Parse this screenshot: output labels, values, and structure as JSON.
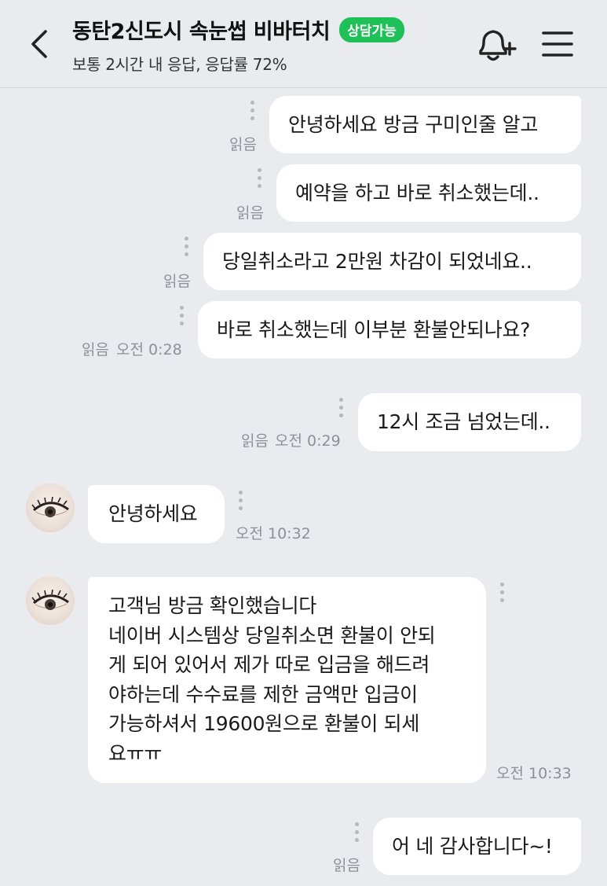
{
  "header": {
    "title": "동탄2신도시 속눈썹 비바터치",
    "badge": "상담가능",
    "subtitle": "보통 2시간 내 응답, 응답률 72%"
  },
  "messages": [
    {
      "dir": "out",
      "text": "안녕하세요 방금 구미인줄 알고",
      "read": "읽음",
      "time": ""
    },
    {
      "dir": "out",
      "text": "예약을 하고 바로 취소했는데..",
      "read": "읽음",
      "time": ""
    },
    {
      "dir": "out",
      "text": "당일취소라고 2만원 차감이 되었네요..",
      "read": "읽음",
      "time": ""
    },
    {
      "dir": "out",
      "text": "바로 취소했는데 이부분 환불안되나요?",
      "read": "읽음",
      "time": "오전 0:28"
    },
    {
      "dir": "out",
      "text": "12시 조금 넘었는데..",
      "read": "읽음",
      "time": "오전 0:29"
    },
    {
      "dir": "in",
      "text": "안녕하세요",
      "time": "오전 10:32"
    },
    {
      "dir": "in",
      "text": "고객님 방금 확인했습니다\n네이버 시스템상 당일취소면 환불이 안되\n게 되어 있어서 제가 따로 입금을 해드려\n야하는데 수수료를 제한 금액만 입금이\n가능하셔서 19600원으로 환불이 되세\n요ㅠㅠ",
      "time": "오전 10:33"
    },
    {
      "dir": "out",
      "text": "어 네 감사합니다~!",
      "read": "읽음",
      "time": ""
    }
  ],
  "colors": {
    "background": "#e9ebef",
    "bubble": "#ffffff",
    "badge": "#1fc057",
    "meta_text": "#8d9096"
  },
  "icons": {
    "back": "chevron-left-icon",
    "bell": "bell-plus-icon",
    "menu": "hamburger-menu-icon",
    "more": "vertical-dots-icon"
  }
}
